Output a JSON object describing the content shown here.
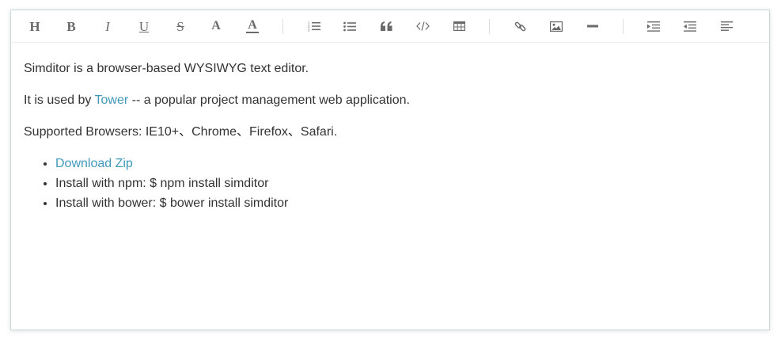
{
  "toolbar": {
    "buttons": [
      {
        "name": "title-icon",
        "glyph": "H"
      },
      {
        "name": "bold-icon",
        "glyph": "B"
      },
      {
        "name": "italic-icon",
        "glyph": "I"
      },
      {
        "name": "underline-icon",
        "glyph": "U"
      },
      {
        "name": "strikethrough-icon",
        "glyph": "S"
      },
      {
        "name": "font-scale-icon",
        "glyph": "A"
      },
      {
        "name": "font-color-icon",
        "glyph": "A"
      },
      {
        "name": "ordered-list-icon"
      },
      {
        "name": "unordered-list-icon"
      },
      {
        "name": "blockquote-icon"
      },
      {
        "name": "code-icon"
      },
      {
        "name": "table-icon"
      },
      {
        "name": "link-icon"
      },
      {
        "name": "image-icon"
      },
      {
        "name": "horizontal-rule-icon"
      },
      {
        "name": "indent-icon"
      },
      {
        "name": "outdent-icon"
      },
      {
        "name": "alignment-icon"
      }
    ]
  },
  "content": {
    "p1": "Simditor is a browser-based WYSIWYG text editor.",
    "p2_before": "It is used by ",
    "p2_link": "Tower",
    "p2_after": " -- a popular project management web application.",
    "p3": "Supported Browsers: IE10+、Chrome、Firefox、Safari.",
    "list": [
      {
        "text": "Download Zip",
        "link": true
      },
      {
        "text": "Install with npm: $ npm install simditor",
        "link": false
      },
      {
        "text": "Install with bower: $ bower install simditor",
        "link": false
      }
    ]
  },
  "colors": {
    "link": "#4298ba",
    "text": "#333333",
    "icon": "#6a6a6a",
    "border": "#c9d8db"
  }
}
